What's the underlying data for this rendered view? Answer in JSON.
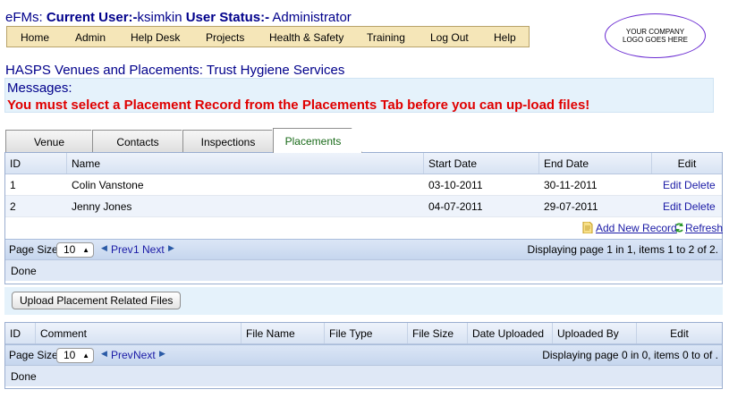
{
  "header": {
    "app_name": "eFMs:",
    "current_user_label": "Current User:-",
    "current_user": "ksimkin",
    "user_status_label": "User Status:-",
    "user_status": "Administrator"
  },
  "nav": {
    "items": [
      "Home",
      "Admin",
      "Help Desk",
      "Projects",
      "Health & Safety",
      "Training",
      "Log Out",
      "Help"
    ]
  },
  "logo_text": "YOUR COMPANY LOGO GOES HERE",
  "page_title": "HASPS Venues and Placements: Trust Hygiene Services",
  "messages": {
    "label": "Messages:",
    "text": "You must select a Placement Record from the Placements Tab before you can up-load files!"
  },
  "tabs": {
    "items": [
      "Venue",
      "Contacts",
      "Inspections",
      "Placements"
    ],
    "active": "Placements"
  },
  "placements_grid": {
    "columns": [
      "ID",
      "Name",
      "Start Date",
      "End Date",
      "Edit"
    ],
    "rows": [
      {
        "id": "1",
        "name": "Colin Vanstone",
        "start": "03-10-2011",
        "end": "30-11-2011",
        "edit": "Edit",
        "delete": "Delete"
      },
      {
        "id": "2",
        "name": "Jenny Jones",
        "start": "04-07-2011",
        "end": "29-07-2011",
        "edit": "Edit",
        "delete": "Delete"
      }
    ],
    "add_new_record": "Add New Record",
    "refresh": "Refresh",
    "page_size_label": "Page Size:",
    "page_size": "10",
    "prev": "Prev",
    "page_number": "1",
    "next": "Next",
    "displaying": "Displaying page 1 in 1, items 1 to 2 of 2.",
    "status": "Done"
  },
  "upload_button": "Upload Placement Related Files",
  "files_grid": {
    "columns": [
      "ID",
      "Comment",
      "File Name",
      "File Type",
      "File Size",
      "Date Uploaded",
      "Uploaded By",
      "Edit"
    ],
    "page_size_label": "Page Size:",
    "page_size": "10",
    "prev": "Prev",
    "next": "Next",
    "displaying": "Displaying page 0 in 0, items 0 to of .",
    "status": "Done"
  },
  "colors": {
    "nav_bg": "#f5e6b8",
    "title_blue": "#00008b",
    "message_red": "#e00000",
    "grid_header": "#d8e3f3",
    "link_blue": "#1a1aa6"
  }
}
